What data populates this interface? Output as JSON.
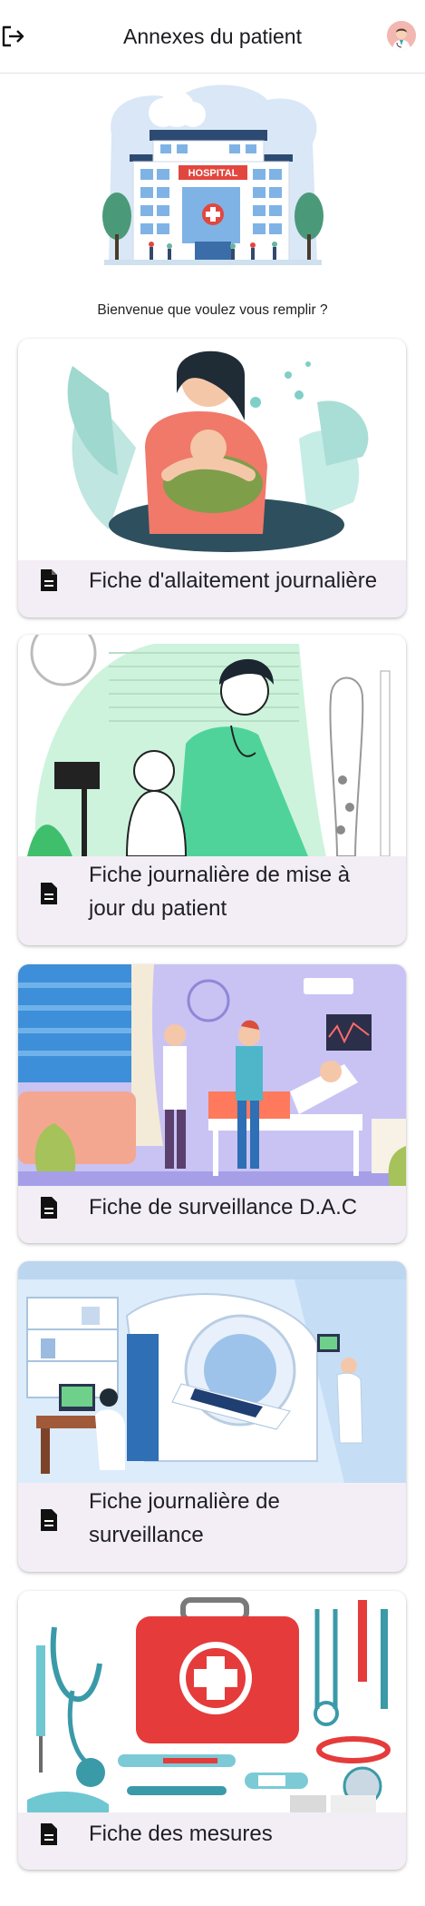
{
  "header": {
    "title": "Annexes du patient",
    "logout_icon": "logout-icon",
    "avatar_icon": "doctor-avatar"
  },
  "hero": {
    "sign_text": "HOSPITAL",
    "welcome": "Bienvenue que voulez vous remplir ?"
  },
  "cards": [
    {
      "label": "Fiche d'allaitement journalière",
      "illustration": "breastfeeding-illustration",
      "icon": "document-icon"
    },
    {
      "label": "Fiche journalière de mise à jour du patient",
      "illustration": "doctor-baby-illustration",
      "icon": "document-icon"
    },
    {
      "label": "Fiche de surveillance D.A.C",
      "illustration": "hospital-room-illustration",
      "icon": "document-icon"
    },
    {
      "label": "Fiche journalière de surveillance",
      "illustration": "mri-scanner-illustration",
      "icon": "document-icon"
    },
    {
      "label": "Fiche des mesures",
      "illustration": "medical-kit-illustration",
      "icon": "document-icon"
    }
  ],
  "colors": {
    "card_background": "#f3eef6",
    "hospital_sign": "#e2473f",
    "primary_text": "#1f1f24"
  }
}
